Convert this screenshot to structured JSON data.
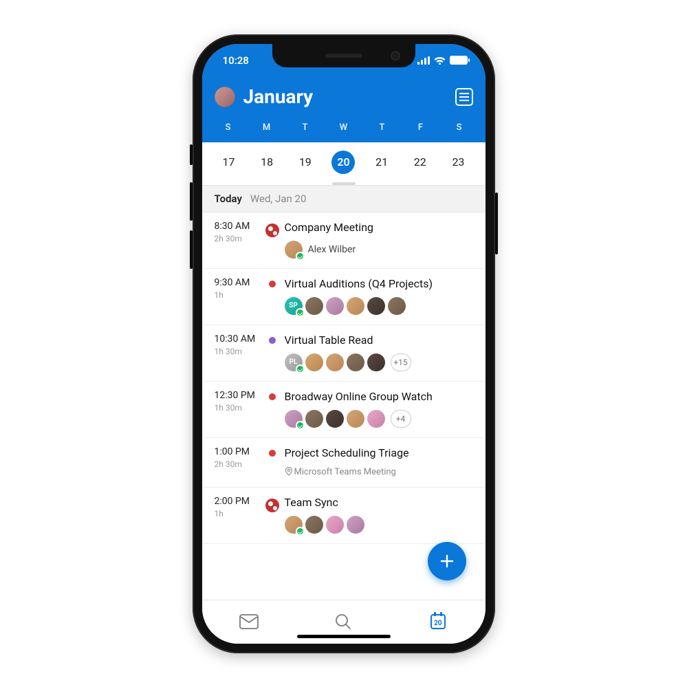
{
  "status": {
    "time": "10:28"
  },
  "header": {
    "month": "January",
    "days_of_week": [
      "S",
      "M",
      "T",
      "W",
      "T",
      "F",
      "S"
    ],
    "dates": [
      17,
      18,
      19,
      20,
      21,
      22,
      23
    ],
    "selected_date": 20
  },
  "section": {
    "label": "Today",
    "date_text": "Wed, Jan 20"
  },
  "events": [
    {
      "time": "8:30 AM",
      "duration": "2h 30m",
      "dot": "lg",
      "title": "Company Meeting",
      "organizer": {
        "name": "Alex Wilber",
        "checked": true,
        "color": "c1"
      },
      "attendees": [],
      "more": null,
      "location": null
    },
    {
      "time": "9:30 AM",
      "duration": "1h",
      "dot": "red",
      "title": "Virtual Auditions (Q4 Projects)",
      "organizer": null,
      "attendees": [
        {
          "label": "SP",
          "color": "c0",
          "checked": true
        },
        {
          "label": "",
          "color": "c2",
          "checked": false
        },
        {
          "label": "",
          "color": "c3",
          "checked": false
        },
        {
          "label": "",
          "color": "c1",
          "checked": false
        },
        {
          "label": "",
          "color": "c4",
          "checked": false
        },
        {
          "label": "",
          "color": "c2",
          "checked": false
        }
      ],
      "more": null,
      "location": null
    },
    {
      "time": "10:30 AM",
      "duration": "1h 30m",
      "dot": "purple",
      "title": "Virtual Table Read",
      "organizer": null,
      "attendees": [
        {
          "label": "PL",
          "color": "c5",
          "checked": true
        },
        {
          "label": "",
          "color": "c6",
          "checked": false
        },
        {
          "label": "",
          "color": "c1",
          "checked": false
        },
        {
          "label": "",
          "color": "c2",
          "checked": false
        },
        {
          "label": "",
          "color": "c4",
          "checked": false
        }
      ],
      "more": "+15",
      "location": null
    },
    {
      "time": "12:30 PM",
      "duration": "1h 30m",
      "dot": "red",
      "title": "Broadway Online Group Watch",
      "organizer": null,
      "attendees": [
        {
          "label": "",
          "color": "c3",
          "checked": true
        },
        {
          "label": "",
          "color": "c2",
          "checked": false
        },
        {
          "label": "",
          "color": "c4",
          "checked": false
        },
        {
          "label": "",
          "color": "c1",
          "checked": false
        },
        {
          "label": "",
          "color": "c7",
          "checked": false
        }
      ],
      "more": "+4",
      "location": null
    },
    {
      "time": "1:00 PM",
      "duration": "2h 30m",
      "dot": "red",
      "title": "Project Scheduling Triage",
      "organizer": null,
      "attendees": [],
      "more": null,
      "location": "Microsoft Teams Meeting"
    },
    {
      "time": "2:00 PM",
      "duration": "1h",
      "dot": "lg",
      "title": "Team Sync",
      "organizer": null,
      "attendees": [
        {
          "label": "",
          "color": "c1",
          "checked": true
        },
        {
          "label": "",
          "color": "c2",
          "checked": false
        },
        {
          "label": "",
          "color": "c7",
          "checked": false
        },
        {
          "label": "",
          "color": "c3",
          "checked": false
        }
      ],
      "more": null,
      "location": null
    }
  ],
  "bottom_nav": {
    "calendar_badge": "20"
  },
  "colors": {
    "brand": "#0a77d9",
    "dot_red": "#d83b3b",
    "dot_purple": "#8e5bd6"
  }
}
